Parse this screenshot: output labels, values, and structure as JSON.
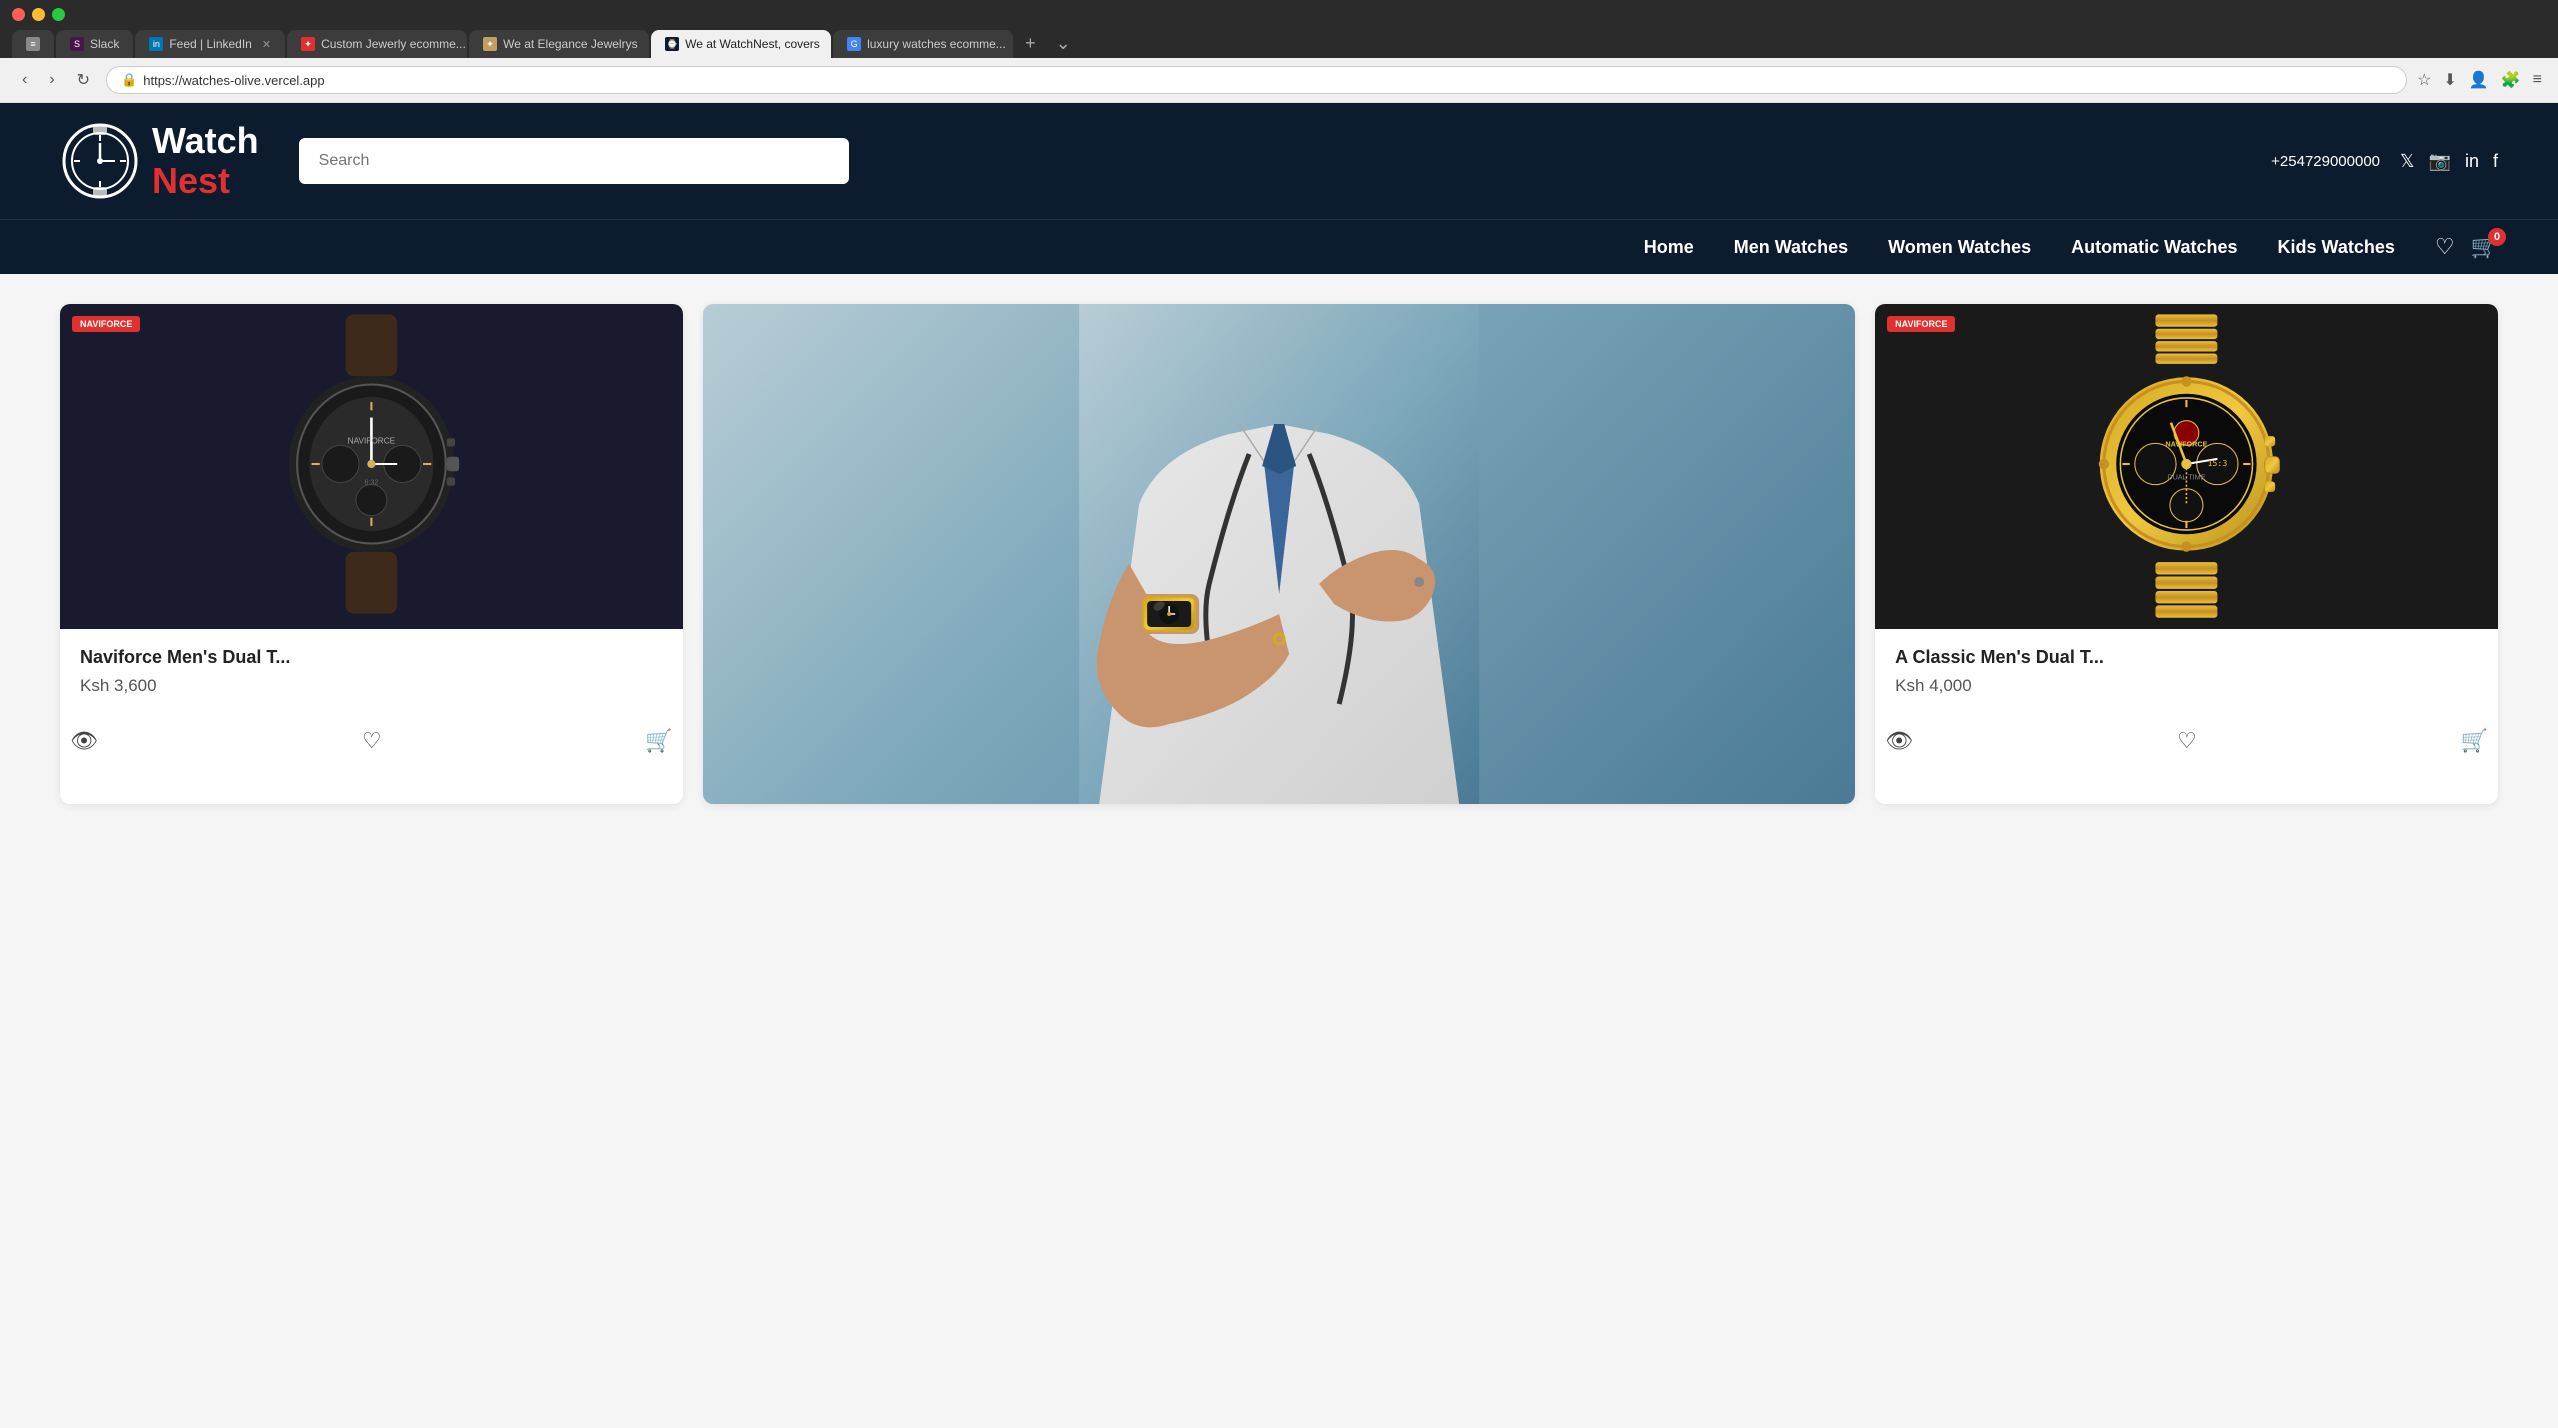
{
  "browser": {
    "tabs": [
      {
        "id": "tab-slack",
        "label": "Slack",
        "active": false,
        "icon": "#",
        "closable": false
      },
      {
        "id": "tab-linkedin",
        "label": "Feed | LinkedIn",
        "active": false,
        "icon": "in",
        "closable": true
      },
      {
        "id": "tab-custom-jewelry",
        "label": "Custom Jewerly ecomme...",
        "active": false,
        "icon": "✦",
        "closable": true
      },
      {
        "id": "tab-elegance",
        "label": "We at Elegance Jewelrys",
        "active": false,
        "icon": "✦",
        "closable": true
      },
      {
        "id": "tab-watchnest",
        "label": "We at WatchNest, covers",
        "active": true,
        "icon": "⌚",
        "closable": true
      },
      {
        "id": "tab-luxury",
        "label": "luxury watches ecomme...",
        "active": false,
        "icon": "G",
        "closable": true
      }
    ],
    "url": "https://watches-olive.vercel.app"
  },
  "site": {
    "logo": {
      "watch_text": "Watch",
      "nest_text": "Nest"
    },
    "search": {
      "placeholder": "Search"
    },
    "contact": {
      "phone": "+254729000000"
    },
    "nav": {
      "links": [
        {
          "id": "home",
          "label": "Home"
        },
        {
          "id": "men-watches",
          "label": "Men Watches"
        },
        {
          "id": "women-watches",
          "label": "Women Watches"
        },
        {
          "id": "automatic-watches",
          "label": "Automatic Watches"
        },
        {
          "id": "kids-watches",
          "label": "Kids Watches"
        }
      ]
    },
    "products": [
      {
        "id": "product-1",
        "brand": "NAVIFORCE",
        "title": "Naviforce Men's Dual T...",
        "price": "Ksh 3,600",
        "type": "dark-watch"
      },
      {
        "id": "product-hero",
        "type": "hero",
        "alt": "Man wearing gold watch adjusting tie"
      },
      {
        "id": "product-2",
        "brand": "NAVIFORCE",
        "title": "A Classic Men's Dual T...",
        "price": "Ksh 4,000",
        "type": "gold-watch"
      }
    ],
    "cart_count": "0",
    "social": {
      "twitter": "Twitter",
      "instagram": "Instagram",
      "linkedin": "LinkedIn",
      "facebook": "Facebook"
    }
  }
}
